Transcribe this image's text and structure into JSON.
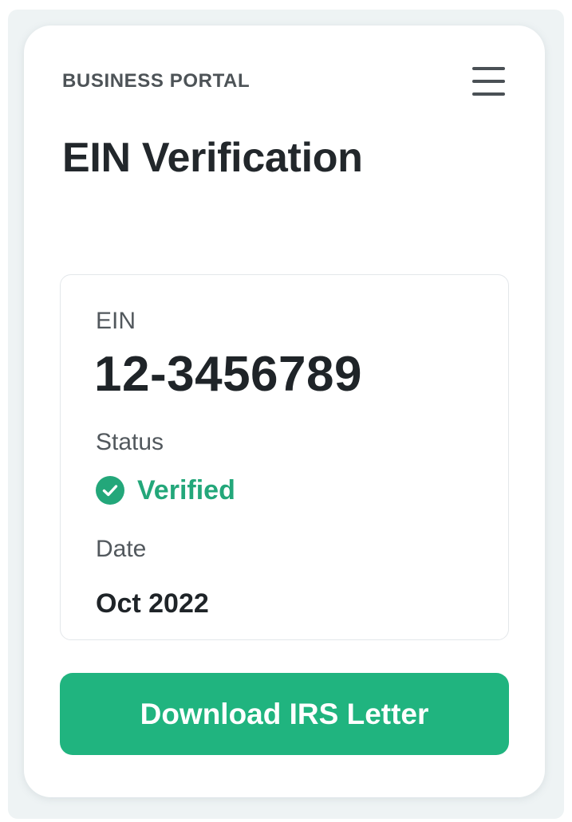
{
  "header": {
    "brand": "BUSINESS PORTAL",
    "menu_icon": "hamburger-menu-icon"
  },
  "page": {
    "title": "EIN Verification"
  },
  "ein_card": {
    "ein_label": "EIN",
    "ein_value": "12-3456789",
    "status_label": "Status",
    "status_value": "Verified",
    "status_icon": "check-circle-icon",
    "date_label": "Date",
    "date_value": "Oct 2022"
  },
  "actions": {
    "download_label": "Download IRS Letter"
  },
  "colors": {
    "accent": "#20b47f",
    "status_success": "#23a77a",
    "text_primary": "#1f2428",
    "text_secondary": "#52585d",
    "backdrop": "#eef3f4"
  }
}
